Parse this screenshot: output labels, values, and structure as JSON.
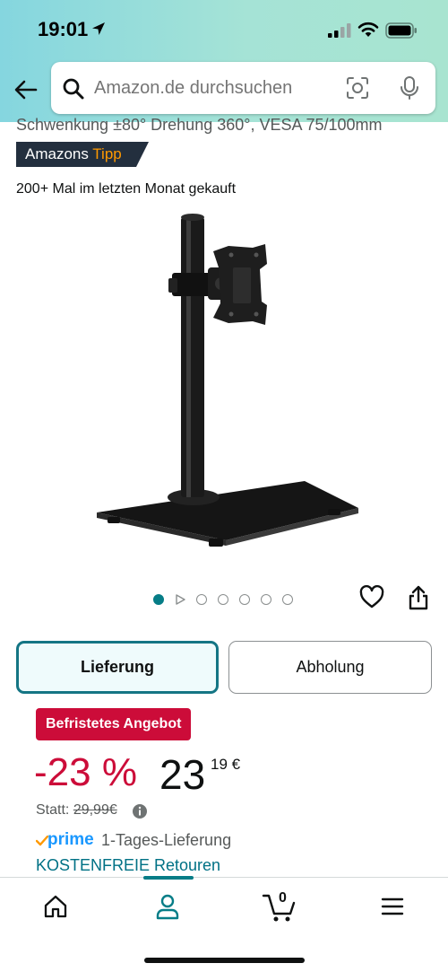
{
  "status_bar": {
    "time": "19:01"
  },
  "search": {
    "placeholder": "Amazon.de durchsuchen"
  },
  "product": {
    "title_fragment": "Schwenkung ±80° Drehung 360°, VESA 75/100mm",
    "badge_prefix": "Amazons",
    "badge_suffix": "Tipp",
    "bought_text": "200+ Mal im letzten Monat gekauft"
  },
  "gallery": {
    "image_count": 6,
    "active_index": 0
  },
  "tabs": {
    "lieferung": "Lieferung",
    "abholung": "Abholung"
  },
  "offer": {
    "deal_label": "Befristetes Angebot",
    "discount": "-23 %",
    "price_whole": "23",
    "price_fraction": "19 €",
    "statt_label": "Statt:",
    "list_price": "29,99€",
    "prime_label": "prime",
    "delivery_text": "1-Tages-Lieferung",
    "returns_text": "KOSTENFREIE Retouren"
  },
  "bottom_nav": {
    "cart_count": "0",
    "active": "account"
  },
  "colors": {
    "header_start": "#85d6df",
    "header_end": "#a8e4d0",
    "accent_teal": "#067d87",
    "deal_red": "#cc0c39",
    "badge_dark": "#232f3e",
    "tipp_orange": "#ff9900",
    "prime_blue": "#1a98ff"
  },
  "icons": [
    "location-arrow-icon",
    "signal-icon",
    "wifi-icon",
    "battery-icon",
    "back-arrow-icon",
    "search-icon",
    "camera-scan-icon",
    "microphone-icon",
    "heart-icon",
    "share-icon",
    "info-icon",
    "prime-check-icon",
    "home-icon",
    "user-icon",
    "cart-icon",
    "menu-icon"
  ]
}
